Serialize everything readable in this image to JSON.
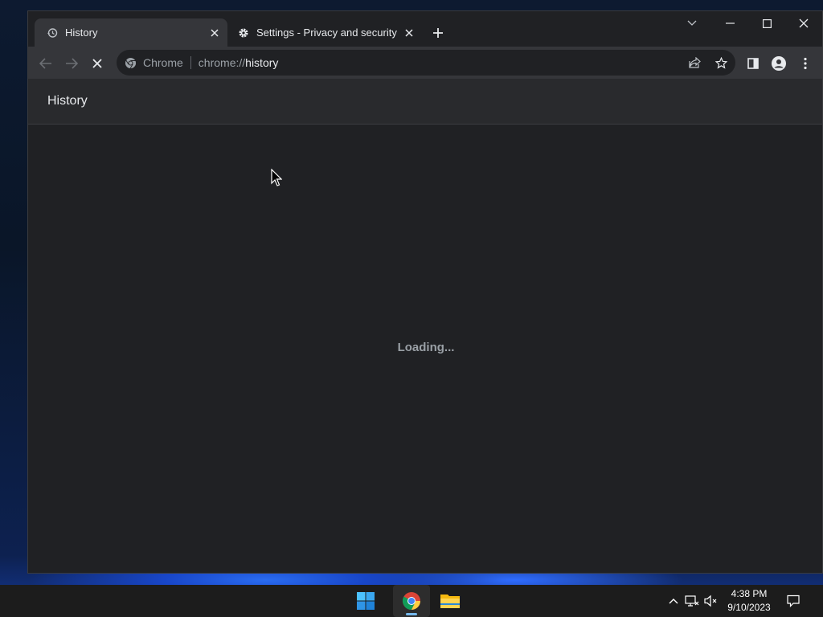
{
  "browser": {
    "tabs": [
      {
        "title": "History",
        "icon": "history-icon",
        "active": true
      },
      {
        "title": "Settings - Privacy and security",
        "icon": "gear-icon",
        "active": false
      }
    ],
    "new_tab_icon": "plus-icon",
    "window_controls": [
      "tab-search-icon",
      "minimize-icon",
      "maximize-icon",
      "close-icon"
    ],
    "omnibox": {
      "site_label": "Chrome",
      "url_scheme": "chrome://",
      "url_path": "history"
    }
  },
  "page": {
    "header_title": "History",
    "loading_text": "Loading..."
  },
  "taskbar": {
    "apps": [
      "windows-start-icon",
      "chrome-icon",
      "file-explorer-icon"
    ],
    "clock": {
      "time": "4:38 PM",
      "date": "9/10/2023"
    }
  },
  "colors": {
    "window_bg": "#202124",
    "toolbar_bg": "#35363a",
    "header_bg": "#292a2d",
    "text": "#e8eaed",
    "muted_text": "#9aa0a6",
    "taskbar_bg": "#1c1c1c"
  }
}
